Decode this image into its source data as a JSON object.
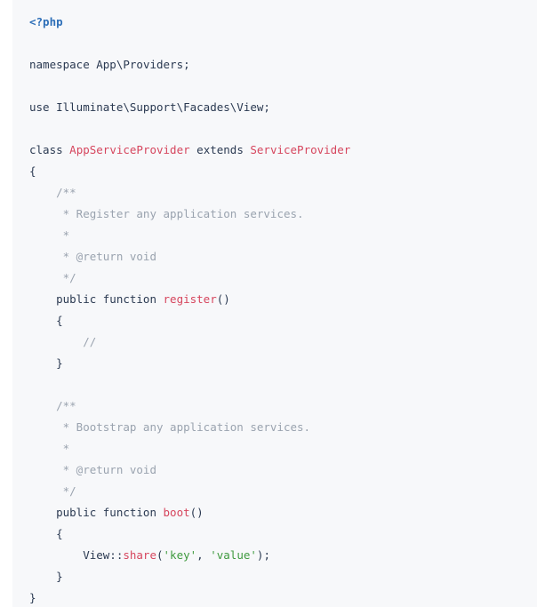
{
  "code_block": {
    "lines": [
      [
        {
          "t": "<?php",
          "c": "tag"
        }
      ],
      [],
      [
        {
          "t": "namespace",
          "c": "kw"
        },
        {
          "t": " App\\Providers;",
          "c": "plain"
        }
      ],
      [],
      [
        {
          "t": "use",
          "c": "kw"
        },
        {
          "t": " Illuminate\\Support\\Facades\\View;",
          "c": "plain"
        }
      ],
      [],
      [
        {
          "t": "class",
          "c": "kw"
        },
        {
          "t": " ",
          "c": "plain"
        },
        {
          "t": "AppServiceProvider",
          "c": "class"
        },
        {
          "t": " extends ",
          "c": "kw"
        },
        {
          "t": "ServiceProvider",
          "c": "class"
        }
      ],
      [
        {
          "t": "{",
          "c": "punct"
        }
      ],
      [
        {
          "t": "    /**",
          "c": "comment"
        }
      ],
      [
        {
          "t": "     * Register any application services.",
          "c": "comment"
        }
      ],
      [
        {
          "t": "     *",
          "c": "comment"
        }
      ],
      [
        {
          "t": "     * @return void",
          "c": "comment"
        }
      ],
      [
        {
          "t": "     */",
          "c": "comment"
        }
      ],
      [
        {
          "t": "    public function ",
          "c": "kw"
        },
        {
          "t": "register",
          "c": "fn"
        },
        {
          "t": "()",
          "c": "punct"
        }
      ],
      [
        {
          "t": "    {",
          "c": "punct"
        }
      ],
      [
        {
          "t": "        //",
          "c": "comment"
        }
      ],
      [
        {
          "t": "    }",
          "c": "punct"
        }
      ],
      [],
      [
        {
          "t": "    /**",
          "c": "comment"
        }
      ],
      [
        {
          "t": "     * Bootstrap any application services.",
          "c": "comment"
        }
      ],
      [
        {
          "t": "     *",
          "c": "comment"
        }
      ],
      [
        {
          "t": "     * @return void",
          "c": "comment"
        }
      ],
      [
        {
          "t": "     */",
          "c": "comment"
        }
      ],
      [
        {
          "t": "    public function ",
          "c": "kw"
        },
        {
          "t": "boot",
          "c": "fn"
        },
        {
          "t": "()",
          "c": "punct"
        }
      ],
      [
        {
          "t": "    {",
          "c": "punct"
        }
      ],
      [
        {
          "t": "        View::",
          "c": "plain"
        },
        {
          "t": "share",
          "c": "fn"
        },
        {
          "t": "(",
          "c": "punct"
        },
        {
          "t": "'key'",
          "c": "str"
        },
        {
          "t": ", ",
          "c": "punct"
        },
        {
          "t": "'value'",
          "c": "str"
        },
        {
          "t": ");",
          "c": "punct"
        }
      ],
      [
        {
          "t": "    }",
          "c": "punct"
        }
      ],
      [
        {
          "t": "}",
          "c": "punct"
        }
      ]
    ]
  }
}
